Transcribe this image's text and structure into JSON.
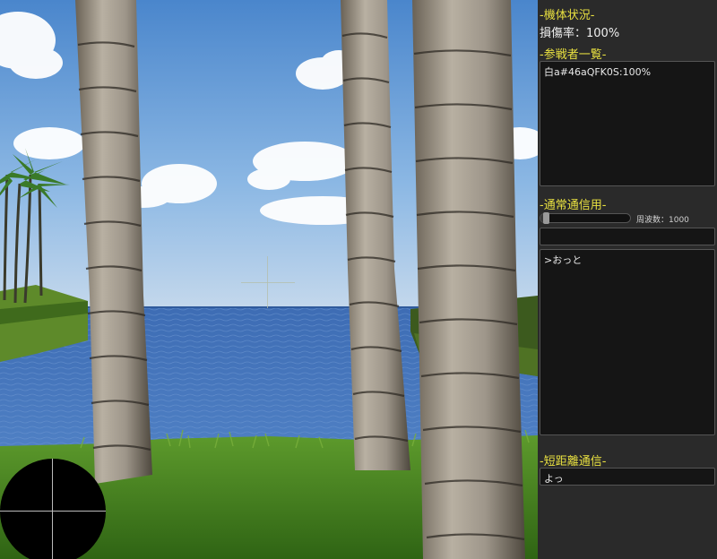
{
  "hud": {
    "crosshair_icon": "crosshair-icon",
    "radar_icon": "radar-icon"
  },
  "panel": {
    "status_title": "-機体状況-",
    "damage": "損傷率：100%",
    "participants_title": "-参戦者一覧-",
    "participants": [
      "白a#46aQFK0S:100%"
    ],
    "normal_comm_title": "-通常通信用-",
    "frequency_label": "周波数：1000",
    "frequency_level": 0.03,
    "normal_comm_input": "",
    "chat_log": [
      ">おっと"
    ],
    "short_comm_title": "-短距離通信-",
    "short_comm_input": "よっ"
  },
  "colors": {
    "panel_bg": "#2a2a2a",
    "title_yellow": "#e8e040",
    "box_bg": "#151515"
  }
}
